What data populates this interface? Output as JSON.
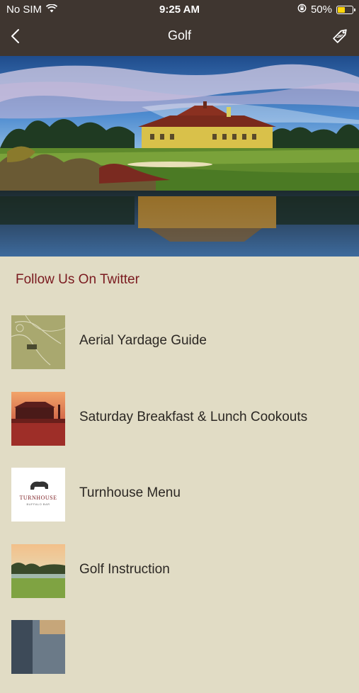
{
  "status_bar": {
    "carrier": "No SIM",
    "time": "9:25 AM",
    "battery_percent_label": "50%",
    "battery_level": 0.5,
    "icons": [
      "wifi-icon",
      "orientation-lock-icon",
      "battery-icon"
    ]
  },
  "navbar": {
    "title": "Golf",
    "back_icon": "chevron-left-icon",
    "action_icon": "tag-icon"
  },
  "hero": {
    "image": "clubhouse-across-lake-photo"
  },
  "section": {
    "title": "Follow Us On Twitter"
  },
  "menu": {
    "items": [
      {
        "label": "Aerial Yardage Guide",
        "thumb": "yardage-map-thumbnail"
      },
      {
        "label": "Saturday Breakfast & Lunch Cookouts",
        "thumb": "clubhouse-sunset-thumbnail"
      },
      {
        "label": "Turnhouse Menu",
        "thumb": "turnhouse-logo-thumbnail",
        "thumb_text": "TURNHOUSE",
        "thumb_subtext": "BUFFALO BAR"
      },
      {
        "label": "Golf Instruction",
        "thumb": "course-sunset-thumbnail"
      },
      {
        "label": "",
        "thumb": "partial-thumbnail"
      }
    ]
  },
  "colors": {
    "bar_bg": "#3f3630",
    "page_bg": "#e1dcc5",
    "section_title": "#7a1a1f",
    "battery_fill": "#ffd60a"
  }
}
